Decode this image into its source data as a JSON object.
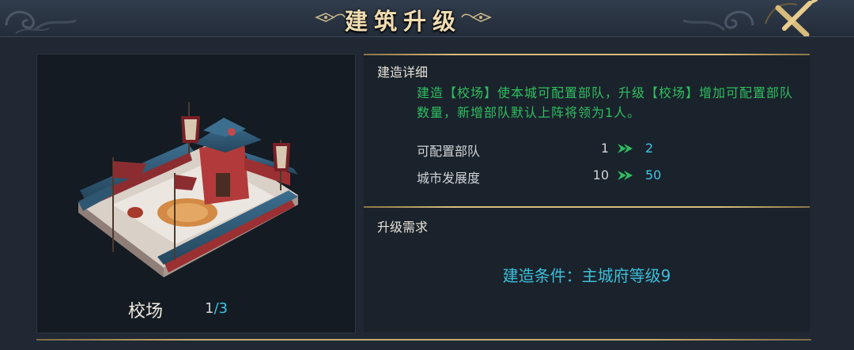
{
  "header": {
    "title": "建筑升级"
  },
  "building": {
    "name": "校场",
    "count": "1",
    "separator": "/",
    "max": "3"
  },
  "details": {
    "title": "建造详细",
    "description": "建造【校场】使本城可配置部队，升级【校场】增加可配置部队数量，新增部队默认上阵将领为1人。",
    "stats": [
      {
        "label": "可配置部队",
        "from": "1",
        "to": "2"
      },
      {
        "label": "城市发展度",
        "from": "10",
        "to": "50"
      }
    ]
  },
  "requirements": {
    "title": "升级需求",
    "condition": "建造条件：主城府等级9"
  },
  "colors": {
    "background": "#1f2833",
    "title_gold": "#f1ddb2",
    "description_green": "#2fbf5e",
    "value_cyan": "#3ec7e6",
    "divider_gold": "#d9bd7e"
  }
}
